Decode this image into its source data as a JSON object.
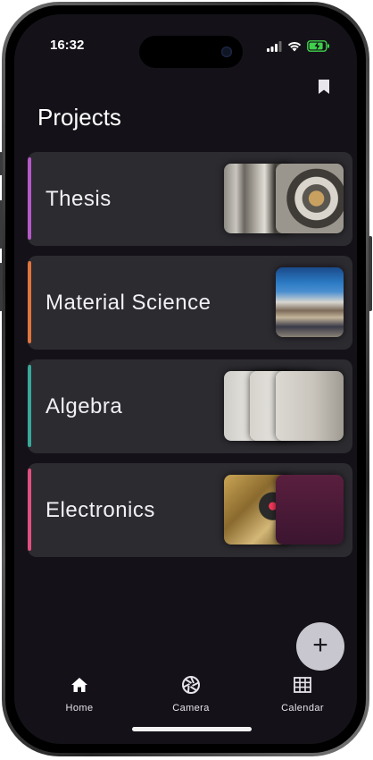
{
  "status_bar": {
    "time": "16:32"
  },
  "page": {
    "title": "Projects"
  },
  "projects": [
    {
      "name": "Thesis",
      "accent_color": "#b45ac6"
    },
    {
      "name": "Material Science",
      "accent_color": "#e0743e"
    },
    {
      "name": "Algebra",
      "accent_color": "#3aa899"
    },
    {
      "name": "Electronics",
      "accent_color": "#e0507e"
    }
  ],
  "fab": {
    "icon": "plus-icon"
  },
  "bottom_nav": [
    {
      "label": "Home",
      "icon": "home-icon"
    },
    {
      "label": "Camera",
      "icon": "camera-shutter-icon"
    },
    {
      "label": "Calendar",
      "icon": "calendar-grid-icon"
    }
  ]
}
